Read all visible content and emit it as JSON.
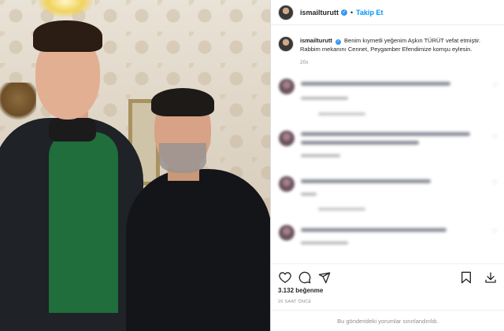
{
  "header": {
    "username": "ismailturutt",
    "verified_icon": "verified-badge-icon",
    "separator": "•",
    "follow_label": "Takip Et"
  },
  "caption": {
    "username": "ismailturutt",
    "text_line1": "Benim kıymetli yeğenim Aşkın TÜRÜT vefat etmiştir.",
    "text_line2": "Rabbim mekanını Cennet, Peygamber Efendimize komşu eylesin.",
    "age": "20s"
  },
  "comments": {
    "count_visible": 4,
    "blurred": true
  },
  "actions": {
    "icons": [
      "heart-icon",
      "comment-icon",
      "share-icon",
      "bookmark-icon",
      "download-icon"
    ]
  },
  "stats": {
    "likes": "3.132 beğenme",
    "posted_ago": "20 SAAT ÖNCE"
  },
  "footer": {
    "comments_restricted": "Bu gönderideki yorumlar sınırlandırıldı."
  },
  "colors": {
    "accent": "#0095f6",
    "verified": "#3897f0",
    "muted": "#8e8e8e",
    "text": "#262626"
  }
}
